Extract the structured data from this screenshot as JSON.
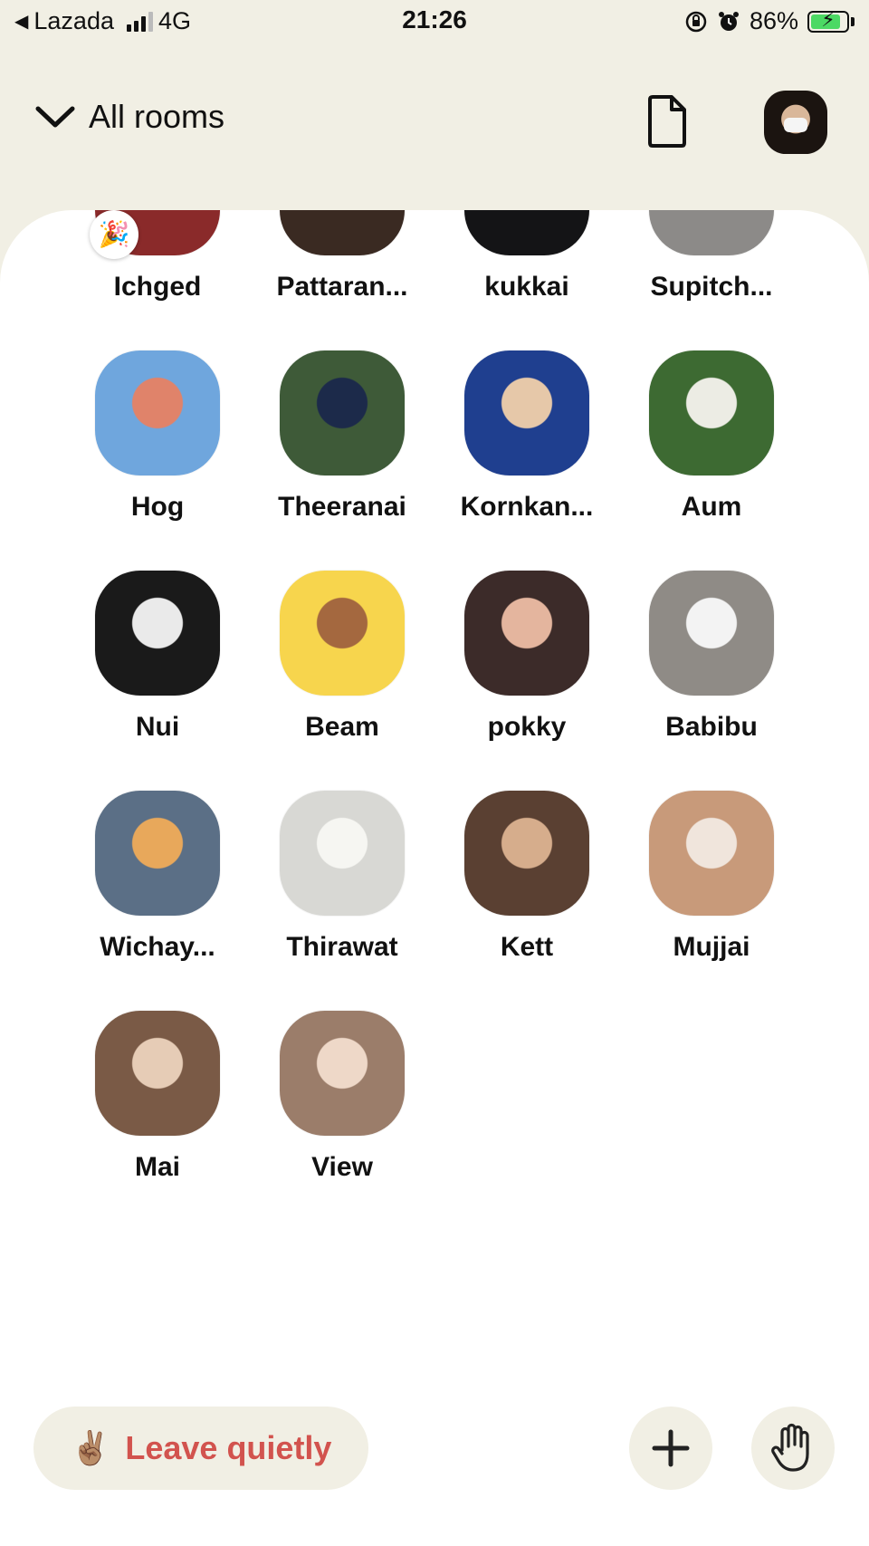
{
  "status_bar": {
    "back_app": "Lazada",
    "network": "4G",
    "time": "21:26",
    "battery": "86%",
    "battery_level": 0.86
  },
  "header": {
    "rooms_label": "All rooms"
  },
  "participants": [
    {
      "name": "Ichged",
      "colors": [
        "#8a2a2a",
        "#d9b8a0"
      ],
      "badge": "🎉"
    },
    {
      "name": "Pattaran...",
      "colors": [
        "#3a2a22",
        "#c49a78"
      ]
    },
    {
      "name": "kukkai",
      "colors": [
        "#141416",
        "#cfa889"
      ]
    },
    {
      "name": "Supitch...",
      "colors": [
        "#8c8a88",
        "#e5c9a6"
      ]
    },
    {
      "name": "Hog",
      "colors": [
        "#6fa6dd",
        "#e0836a"
      ]
    },
    {
      "name": "Theeranai",
      "colors": [
        "#3e5a38",
        "#1c2a4a"
      ]
    },
    {
      "name": "Kornkan...",
      "colors": [
        "#1f3f8f",
        "#e6c8a9"
      ]
    },
    {
      "name": "Aum",
      "colors": [
        "#3d6a32",
        "#ecece4"
      ]
    },
    {
      "name": "Nui",
      "colors": [
        "#1a1a1a",
        "#eaeaea"
      ]
    },
    {
      "name": "Beam",
      "colors": [
        "#f7d54d",
        "#a4683f"
      ]
    },
    {
      "name": "pokky",
      "colors": [
        "#3c2b29",
        "#e4b59e"
      ]
    },
    {
      "name": "Babibu",
      "colors": [
        "#8f8b86",
        "#f3f3f3"
      ]
    },
    {
      "name": "Wichay...",
      "colors": [
        "#5b6f86",
        "#e8a85b"
      ]
    },
    {
      "name": "Thirawat",
      "colors": [
        "#d8d8d4",
        "#f6f6f2"
      ]
    },
    {
      "name": "Kett",
      "colors": [
        "#5a4032",
        "#d6ad8c"
      ]
    },
    {
      "name": "Mujjai",
      "colors": [
        "#c89a7a",
        "#f0e5dc"
      ]
    },
    {
      "name": "Mai",
      "colors": [
        "#7a5a46",
        "#e6ccb6"
      ]
    },
    {
      "name": "View",
      "colors": [
        "#9b7d6a",
        "#eed8c8"
      ]
    }
  ],
  "actions": {
    "leave_emoji": "✌🏽",
    "leave_label": "Leave quietly",
    "leave_color": "#d2534e"
  }
}
